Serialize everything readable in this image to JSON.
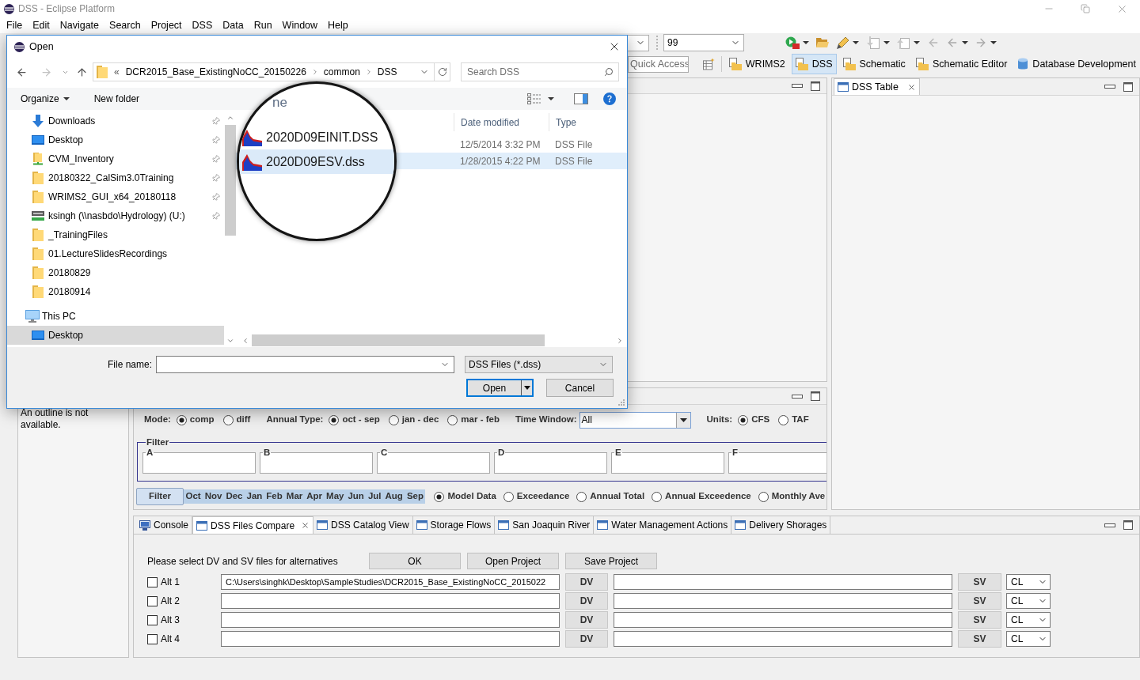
{
  "window": {
    "title": "DSS - Eclipse Platform"
  },
  "menu": [
    "File",
    "Edit",
    "Navigate",
    "Search",
    "Project",
    "DSS",
    "Data",
    "Run",
    "Window",
    "Help"
  ],
  "toolbar": {
    "combo_value": "99"
  },
  "quick_access": {
    "placeholder": "Quick Access"
  },
  "perspectives": [
    {
      "label": "WRIMS2",
      "kind": "folder",
      "selected": false
    },
    {
      "label": "DSS",
      "kind": "folder",
      "selected": true
    },
    {
      "label": "Schematic",
      "kind": "folder",
      "selected": false
    },
    {
      "label": "Schematic Editor",
      "kind": "folder",
      "selected": false
    },
    {
      "label": "Database Development",
      "kind": "database",
      "selected": false
    }
  ],
  "open_dialog": {
    "title": "Open",
    "breadcrumb_overflow": "«",
    "breadcrumb": [
      "DCR2015_Base_ExistingNoCC_20150226",
      "common",
      "DSS"
    ],
    "search": {
      "placeholder": "Search DSS"
    },
    "commands": [
      {
        "label": "Organize",
        "menu": true
      },
      {
        "label": "New folder",
        "menu": false
      }
    ],
    "quick_access_items": [
      {
        "label": "Downloads",
        "kind": "downloads",
        "pinned": true,
        "selected": false
      },
      {
        "label": "Desktop",
        "kind": "desktop",
        "pinned": true,
        "selected": false
      },
      {
        "label": "CVM_Inventory",
        "kind": "network",
        "pinned": true,
        "selected": false
      },
      {
        "label": "20180322_CalSim3.0Training",
        "kind": "folder",
        "pinned": true,
        "selected": false
      },
      {
        "label": "WRIMS2_GUI_x64_20180118",
        "kind": "folder",
        "pinned": true,
        "selected": false
      },
      {
        "label": "ksingh (\\\\nasbdo\\Hydrology) (U:)",
        "kind": "drive",
        "pinned": true,
        "selected": false
      },
      {
        "label": "_TrainingFiles",
        "kind": "folder",
        "pinned": false,
        "selected": false
      },
      {
        "label": "01.LectureSlidesRecordings",
        "kind": "folder",
        "pinned": false,
        "selected": false
      },
      {
        "label": "20180829",
        "kind": "folder",
        "pinned": false,
        "selected": false
      },
      {
        "label": "20180914",
        "kind": "folder",
        "pinned": false,
        "selected": false
      }
    ],
    "this_pc": {
      "label": "This PC",
      "selected": false,
      "children": [
        {
          "label": "Desktop",
          "kind": "desktop",
          "selected": true
        }
      ]
    },
    "columns": [
      "ne",
      "Date modified",
      "Type"
    ],
    "files": [
      {
        "name": "2020D09EINIT.DSS",
        "date": "12/5/2014 3:32 PM",
        "type": "DSS File",
        "selected": false
      },
      {
        "name": "2020D09ESV.dss",
        "date": "1/28/2015 4:22 PM",
        "type": "DSS File",
        "selected": true
      }
    ],
    "file_name_label": "File name:",
    "file_type": "DSS Files (*.dss)",
    "open_button": "Open",
    "cancel_button": "Cancel"
  },
  "outline": {
    "message": "An outline is not available."
  },
  "dss_table": {
    "tab": "DSS Table"
  },
  "analysis_panel": {
    "settings": [
      {
        "kind": "radio",
        "label": "Mode:",
        "options": [
          {
            "label": "comp",
            "selected": true
          },
          {
            "label": "diff",
            "selected": false
          }
        ]
      },
      {
        "kind": "radio",
        "label": "Annual Type:",
        "options": [
          {
            "label": "oct - sep",
            "selected": true
          },
          {
            "label": "jan - dec",
            "selected": false
          },
          {
            "label": "mar - feb",
            "selected": false
          }
        ]
      },
      {
        "kind": "combo",
        "label": "Time Window:",
        "value": "All"
      },
      {
        "kind": "radio",
        "label": "Units:",
        "options": [
          {
            "label": "CFS",
            "selected": true
          },
          {
            "label": "TAF",
            "selected": false
          }
        ]
      }
    ],
    "filter": {
      "title": "Filter",
      "fields": [
        {
          "label": "A"
        },
        {
          "label": "B"
        },
        {
          "label": "C"
        },
        {
          "label": "D"
        },
        {
          "label": "E"
        },
        {
          "label": "F"
        }
      ]
    },
    "filter_button": "Filter",
    "months": [
      {
        "label": "Oct",
        "selected": true
      },
      {
        "label": "Nov",
        "selected": true
      },
      {
        "label": "Dec",
        "selected": true
      },
      {
        "label": "Jan",
        "selected": true
      },
      {
        "label": "Feb",
        "selected": true
      },
      {
        "label": "Mar",
        "selected": true
      },
      {
        "label": "Apr",
        "selected": true
      },
      {
        "label": "May",
        "selected": true
      },
      {
        "label": "Jun",
        "selected": true
      },
      {
        "label": "Jul",
        "selected": true
      },
      {
        "label": "Aug",
        "selected": true
      },
      {
        "label": "Sep",
        "selected": true
      }
    ],
    "views": [
      {
        "label": "Model Data",
        "selected": true
      },
      {
        "label": "Exceedance",
        "selected": false
      },
      {
        "label": "Annual Total",
        "selected": false
      },
      {
        "label": "Annual Exceedence",
        "selected": false
      },
      {
        "label": "Monthly Ave",
        "selected": false
      }
    ]
  },
  "bottom_panel": {
    "tabs": [
      {
        "label": "Console",
        "kind": "console",
        "selected": false
      },
      {
        "label": "DSS Files Compare",
        "kind": "view",
        "selected": true
      },
      {
        "label": "DSS Catalog View",
        "kind": "view",
        "selected": false
      },
      {
        "label": "Storage Flows",
        "kind": "view",
        "selected": false
      },
      {
        "label": "San Joaquin River",
        "kind": "view",
        "selected": false
      },
      {
        "label": "Water Management Actions",
        "kind": "view",
        "selected": false
      },
      {
        "label": "Delivery Shorages",
        "kind": "view",
        "selected": false
      }
    ],
    "instruction": "Please select DV and SV files for alternatives",
    "buttons": [
      "OK",
      "Open Project",
      "Save Project"
    ],
    "alternatives": [
      {
        "label": "Alt 1",
        "checked": false,
        "dv_file": "C:\\Users\\singhk\\Desktop\\SampleStudies\\DCR2015_Base_ExistingNoCC_2015022",
        "dv_button": "DV",
        "sv_button": "SV",
        "option": "CL"
      },
      {
        "label": "Alt 2",
        "checked": false,
        "dv_button": "DV",
        "sv_button": "SV",
        "option": "CL"
      },
      {
        "label": "Alt 3",
        "checked": false,
        "dv_button": "DV",
        "sv_button": "SV",
        "option": "CL"
      },
      {
        "label": "Alt 4",
        "checked": false,
        "dv_button": "DV",
        "sv_button": "SV",
        "option": "CL"
      }
    ]
  }
}
